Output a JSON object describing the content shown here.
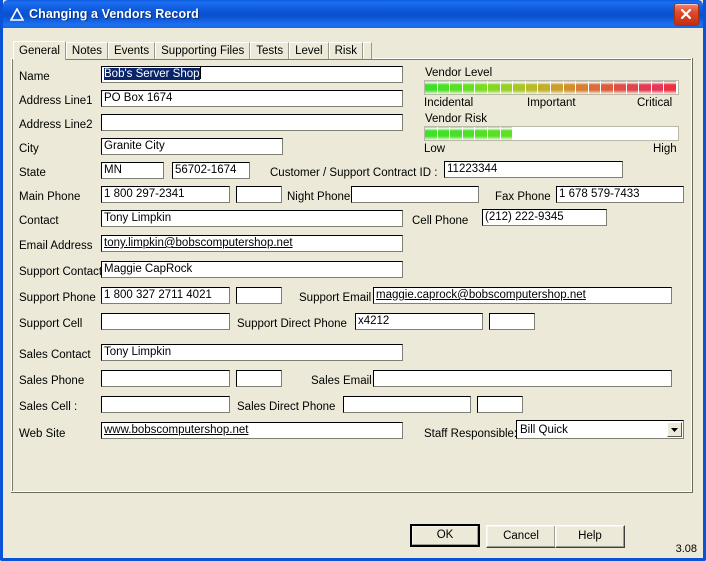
{
  "window": {
    "title": "Changing a Vendors Record",
    "icon": "triangle-icon",
    "close_label": "close-icon",
    "version": "3.08",
    "accent_color": "#0a52d6",
    "face_color": "#ece9d8"
  },
  "tabs": [
    {
      "label": "General",
      "active": true
    },
    {
      "label": "Notes",
      "active": false
    },
    {
      "label": "Events",
      "active": false
    },
    {
      "label": "Supporting Files",
      "active": false
    },
    {
      "label": "Tests",
      "active": false
    },
    {
      "label": "Level",
      "active": false
    },
    {
      "label": "Risk",
      "active": false
    }
  ],
  "fields": {
    "name": {
      "label": "Name",
      "value": "Bob's Server Shop",
      "selected": true
    },
    "address1": {
      "label": "Address Line1",
      "value": "PO Box 1674"
    },
    "address2": {
      "label": "Address Line2",
      "value": ""
    },
    "city": {
      "label": "City",
      "value": "Granite City"
    },
    "state": {
      "label": "State",
      "value": "MN"
    },
    "zip": {
      "value": "56702-1674"
    },
    "contract_id": {
      "label": "Customer / Support Contract ID :",
      "value": "11223344"
    },
    "main_phone": {
      "label": "Main Phone",
      "value": "1 800 297-2341"
    },
    "main_phone_ext": {
      "value": ""
    },
    "night_phone": {
      "label": "Night Phone",
      "value": ""
    },
    "fax_phone": {
      "label": "Fax Phone",
      "value": "1 678 579-7433"
    },
    "contact": {
      "label": "Contact",
      "value": "Tony Limpkin"
    },
    "cell_phone": {
      "label": "Cell Phone",
      "value": "(212) 222-9345"
    },
    "email": {
      "label": "Email Address",
      "value": "tony.limpkin@bobscomputershop.net",
      "link": true
    },
    "support_contact": {
      "label": "Support Contact",
      "value": "Maggie CapRock"
    },
    "support_phone": {
      "label": "Support Phone",
      "value": "1 800 327 2711 4021"
    },
    "support_phone_ext": {
      "value": ""
    },
    "support_email": {
      "label": "Support Email",
      "value": "maggie.caprock@bobscomputershop.net",
      "link": true
    },
    "support_cell": {
      "label": "Support Cell",
      "value": ""
    },
    "support_direct_phone": {
      "label": "Support Direct Phone",
      "value": "x4212"
    },
    "support_direct_ext": {
      "value": ""
    },
    "sales_contact": {
      "label": "Sales Contact",
      "value": "Tony Limpkin"
    },
    "sales_phone": {
      "label": "Sales Phone",
      "value": ""
    },
    "sales_phone_ext": {
      "value": ""
    },
    "sales_email": {
      "label": "Sales Email",
      "value": ""
    },
    "sales_cell": {
      "label": "Sales Cell :",
      "value": ""
    },
    "sales_direct_phone": {
      "label": "Sales Direct Phone",
      "value": ""
    },
    "sales_direct_ext": {
      "value": ""
    },
    "website": {
      "label": "Web Site",
      "value": "www.bobscomputershop.net",
      "link": true
    },
    "staff_responsible": {
      "label": "Staff Responsible:",
      "value": "Bill Quick"
    }
  },
  "meters": {
    "level": {
      "title": "Vendor Level",
      "min_label": "Incidental",
      "mid_label": "Important",
      "max_label": "Critical",
      "segments": 20,
      "filled": 20,
      "colors": [
        "#3ee02a",
        "#4ae025",
        "#57e024",
        "#66e023",
        "#76dd22",
        "#87d722",
        "#98cf22",
        "#a8c624",
        "#b6bb26",
        "#c2ae28",
        "#cb9f2b",
        "#d28f2e",
        "#d77e33",
        "#da6d38",
        "#dc5d3e",
        "#de4f45",
        "#e0444c",
        "#e33b53",
        "#e8355b",
        "#ef3040"
      ]
    },
    "risk": {
      "title": "Vendor Risk",
      "min_label": "Low",
      "max_label": "High",
      "segments": 20,
      "filled": 7,
      "colors": [
        "#3ee02a",
        "#42e028",
        "#47e027",
        "#4ce026",
        "#52e025",
        "#58e024",
        "#5ee023"
      ]
    }
  },
  "buttons": {
    "ok": "OK",
    "cancel": "Cancel",
    "help": "Help"
  }
}
